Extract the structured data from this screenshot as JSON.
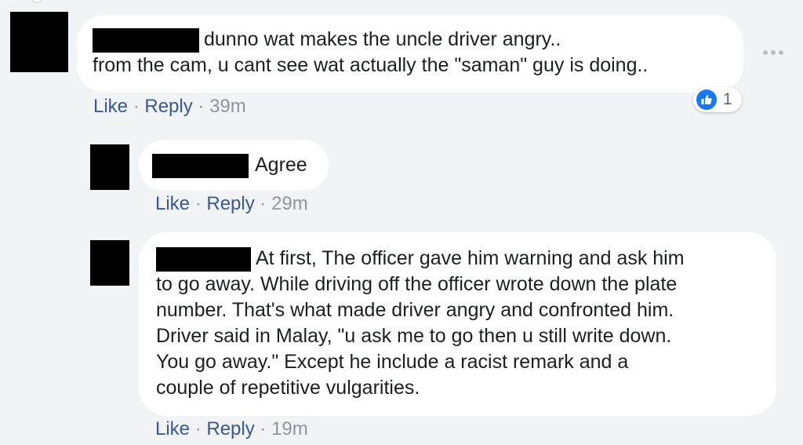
{
  "comments": [
    {
      "text_line1": "dunno wat makes the uncle driver angry..",
      "text_line2": "from the cam, u cant see wat actually the \"saman\" guy is doing..",
      "like": "Like",
      "reply": "Reply",
      "separator": "·",
      "time": "39m",
      "reaction_count": "1"
    },
    {
      "text_line1": "Agree",
      "like": "Like",
      "reply": "Reply",
      "separator": "·",
      "time": "29m"
    },
    {
      "lines": [
        "At first, The officer gave him warning and ask him",
        "to go away. While driving off the officer wrote down the plate",
        "number. That's what made driver angry and confronted him.",
        "Driver said in Malay, \"u ask me to go then u still write down.",
        "You go away.\" Except he include a racist remark and a",
        "couple of repetitive vulgarities."
      ],
      "like": "Like",
      "reply": "Reply",
      "separator": "·",
      "time": "19m"
    }
  ],
  "icons": {
    "more": "more-options-icon",
    "reaction": "like-reaction-icon"
  },
  "colors": {
    "background": "#f2f3f5",
    "bubble": "#ffffff",
    "link": "#385898",
    "meta": "#90949c",
    "like_blue": "#1877f2"
  }
}
